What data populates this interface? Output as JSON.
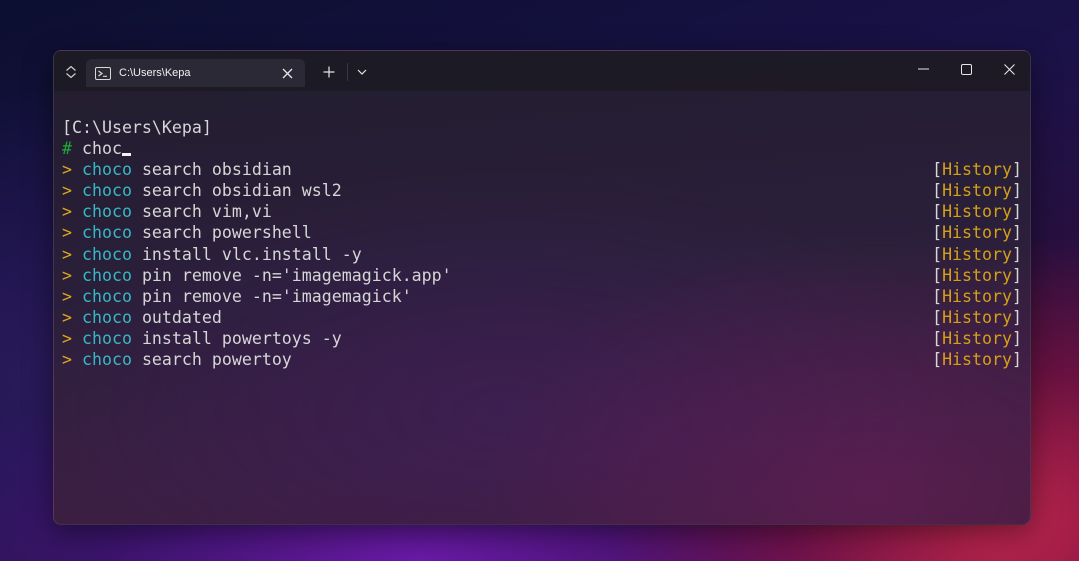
{
  "window": {
    "tab": {
      "title": "C:\\Users\\Kepa",
      "icon": "powershell-icon"
    },
    "buttons": {
      "new_tab": "+",
      "dropdown": "chevron-down-icon",
      "minimize": "minimize-icon",
      "maximize": "maximize-icon",
      "close": "close-icon"
    }
  },
  "terminal": {
    "path_line": "[C:\\Users\\Kepa]",
    "prompt_symbol": "#",
    "input": "choc",
    "suggestion_marker": ">",
    "suggestion_match": "choco",
    "suggestion_tag_open": "[",
    "suggestion_tag": "History",
    "suggestion_tag_close": "]",
    "suggestions": [
      {
        "rest": " search obsidian"
      },
      {
        "rest": " search obsidian wsl2"
      },
      {
        "rest": " search vim,vi"
      },
      {
        "rest": " search powershell"
      },
      {
        "rest": " install vlc.install -y"
      },
      {
        "rest": " pin remove -n='imagemagick.app'"
      },
      {
        "rest": " pin remove -n='imagemagick'"
      },
      {
        "rest": " outdated"
      },
      {
        "rest": " install powertoys -y"
      },
      {
        "rest": " search powertoy"
      }
    ]
  },
  "colors": {
    "prompt_hash": "#1faa3a",
    "suggestion_marker": "#e0a81c",
    "suggestion_match": "#37b8c5",
    "history_tag": "#d4a017"
  }
}
